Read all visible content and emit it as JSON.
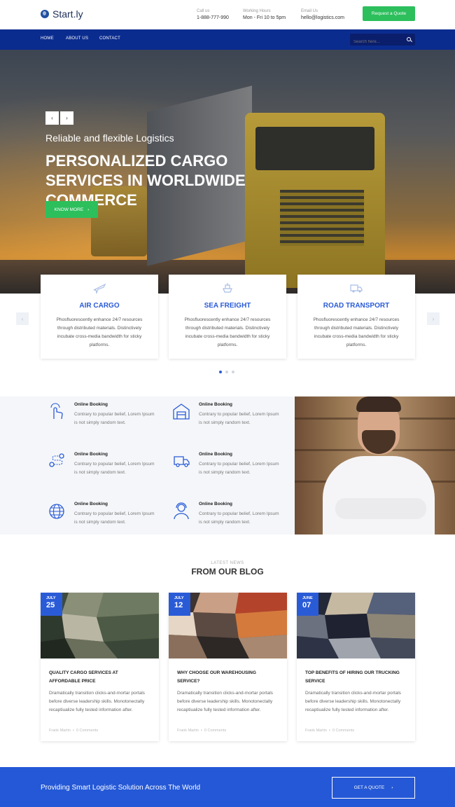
{
  "header": {
    "logo_text": "Start.ly",
    "call_label": "Call us",
    "call_value": "1-888-777-990",
    "hours_label": "Working Hours",
    "hours_value": "Mon - Fri 10 to 5pm",
    "email_label": "Email Us",
    "email_value": "hello@logistics.com",
    "quote_button": "Request a Quote"
  },
  "nav": {
    "items": [
      "HOME",
      "ABOUT US",
      "CONTACT"
    ],
    "search_placeholder": "Search here..."
  },
  "hero": {
    "prev": "‹",
    "next": "›",
    "subtitle": "Reliable and flexible Logistics",
    "title": "PERSONALIZED CARGO SERVICES IN WORLDWIDE COMMERCE",
    "button": "KNOW MORE",
    "button_arrow": "›"
  },
  "services": [
    {
      "title": "AIR CARGO",
      "text": "Phosfluorescently enhance 24/7 resources through distributed materials. Distinctively incubate cross-media bandwidth for sticky platforms.",
      "icon": "airplane-icon"
    },
    {
      "title": "SEA FREIGHT",
      "text": "Phosfluorescently enhance 24/7 resources through distributed materials. Distinctively incubate cross-media bandwidth for sticky platforms.",
      "icon": "ship-icon"
    },
    {
      "title": "ROAD TRANSPORT",
      "text": "Phosfluorescently enhance 24/7 resources through distributed materials. Distinctively incubate cross-media bandwidth for sticky platforms.",
      "icon": "truck-icon"
    }
  ],
  "slider": {
    "prev": "‹",
    "next": "›"
  },
  "features": [
    {
      "title": "Online Booking",
      "text": "Contrary to popular belief, Lorem Ipsum is not simply random text.",
      "icon": "touch-icon"
    },
    {
      "title": "Online Booking",
      "text": "Contrary to popular belief, Lorem Ipsum is not simply random text.",
      "icon": "warehouse-icon"
    },
    {
      "title": "Online Booking",
      "text": "Contrary to popular belief, Lorem Ipsum is not simply random text.",
      "icon": "route-icon"
    },
    {
      "title": "Online Booking",
      "text": "Contrary to popular belief, Lorem Ipsum is not simply random text.",
      "icon": "delivery-truck-icon"
    },
    {
      "title": "Online Booking",
      "text": "Contrary to popular belief, Lorem Ipsum is not simply random text.",
      "icon": "globe-icon"
    },
    {
      "title": "Online Booking",
      "text": "Contrary to popular belief, Lorem Ipsum is not simply random text.",
      "icon": "support-agent-icon"
    }
  ],
  "blog": {
    "kicker": "LATEST NEWS",
    "title": "FROM OUR BLOG",
    "posts": [
      {
        "month": "JULY",
        "day": "25",
        "title": "QUALITY CARGO SERVICES AT AFFORDABLE PRICE",
        "text": "Dramatically transition clicks-and-mortar portals before diverse leadership skills. Monotonectally recaptiualize fully tested information after.",
        "author": "Frank Martin",
        "comments": "0 Comments"
      },
      {
        "month": "JULY",
        "day": "12",
        "title": "WHY CHOOSE OUR WAREHOUSING SERVICE?",
        "text": "Dramatically transition clicks-and-mortar portals before diverse leadership skills. Monotonectally recaptiualize fully tested information after.",
        "author": "Frank Martin",
        "comments": "0 Comments"
      },
      {
        "month": "JUNE",
        "day": "07",
        "title": "TOP BENEFITS OF HIRING OUR TRUCKING SERVICE",
        "text": "Dramatically transition clicks-and-mortar portals before diverse leadership skills. Monotonectally recaptiualize fully tested information after.",
        "author": "Frank Martin",
        "comments": "0 Comments"
      }
    ]
  },
  "cta": {
    "text": "Providing Smart Logistic Solution Across The World",
    "button": "GET A QUOTE",
    "button_arrow": "›"
  },
  "colors": {
    "primary": "#2a5bd7",
    "nav": "#0b2c8f",
    "accent_green": "#2cbf5c"
  }
}
